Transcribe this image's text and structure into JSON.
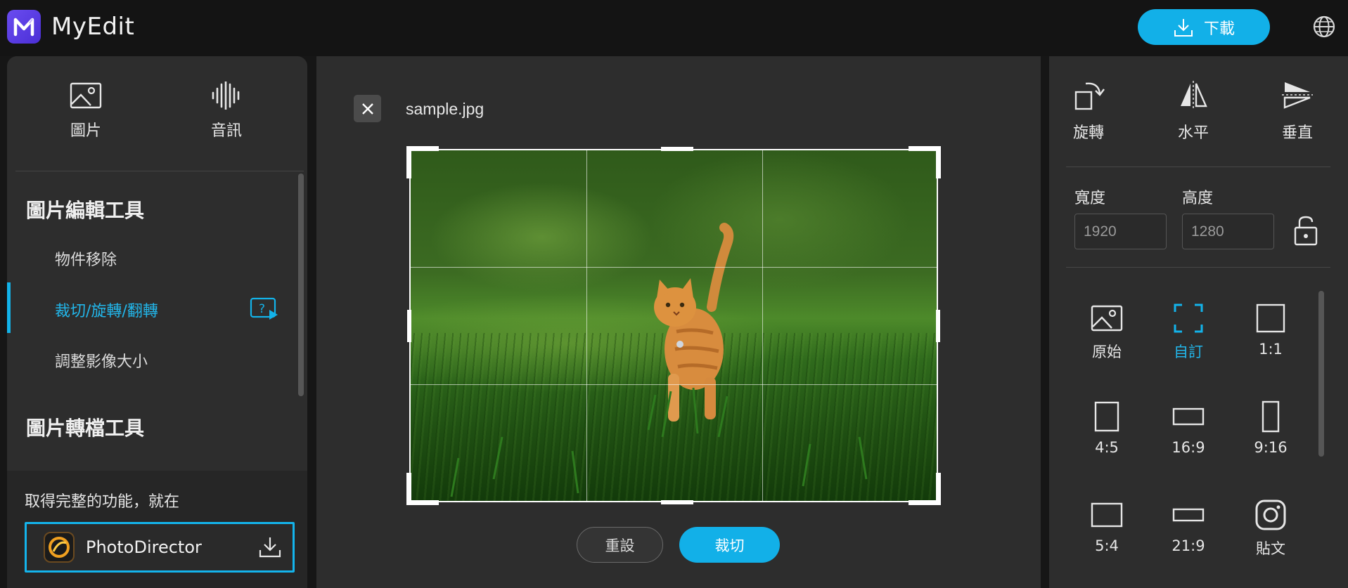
{
  "app": {
    "title": "MyEdit",
    "download_label": "下載"
  },
  "left": {
    "categories": [
      {
        "label": "圖片",
        "icon": "image-icon"
      },
      {
        "label": "音訊",
        "icon": "audio-wave-icon"
      }
    ],
    "sections": [
      {
        "title": "圖片編輯工具",
        "items": [
          {
            "label": "物件移除",
            "active": false
          },
          {
            "label": "裁切/旋轉/翻轉",
            "active": true
          },
          {
            "label": "調整影像大小",
            "active": false
          }
        ]
      },
      {
        "title": "圖片轉檔工具",
        "items": []
      }
    ],
    "promo": {
      "text": "取得完整的功能，就在",
      "product": "PhotoDirector"
    }
  },
  "editor": {
    "filename": "sample.jpg",
    "reset_label": "重設",
    "crop_label": "裁切"
  },
  "right": {
    "tools": [
      {
        "label": "旋轉",
        "icon": "rotate-icon"
      },
      {
        "label": "水平",
        "icon": "flip-horizontal-icon"
      },
      {
        "label": "垂直",
        "icon": "flip-vertical-icon"
      }
    ],
    "width_label": "寬度",
    "height_label": "高度",
    "width_value": "1920",
    "height_value": "1280",
    "ratios": [
      {
        "label": "原始",
        "icon": "original-image-icon",
        "active": false
      },
      {
        "label": "自訂",
        "icon": "custom-crop-icon",
        "active": true
      },
      {
        "label": "1:1",
        "icon": "ratio-1-1-icon",
        "active": false
      },
      {
        "label": "4:5",
        "icon": "ratio-4-5-icon",
        "active": false
      },
      {
        "label": "16:9",
        "icon": "ratio-16-9-icon",
        "active": false
      },
      {
        "label": "9:16",
        "icon": "ratio-9-16-icon",
        "active": false
      },
      {
        "label": "5:4",
        "icon": "ratio-5-4-icon",
        "active": false
      },
      {
        "label": "21:9",
        "icon": "ratio-21-9-icon",
        "active": false
      },
      {
        "label": "貼文",
        "icon": "instagram-icon",
        "active": false
      }
    ]
  },
  "colors": {
    "accent": "#13b3ea",
    "brand": "#5b3de8",
    "panel": "#2d2d2d",
    "background": "#161616"
  }
}
